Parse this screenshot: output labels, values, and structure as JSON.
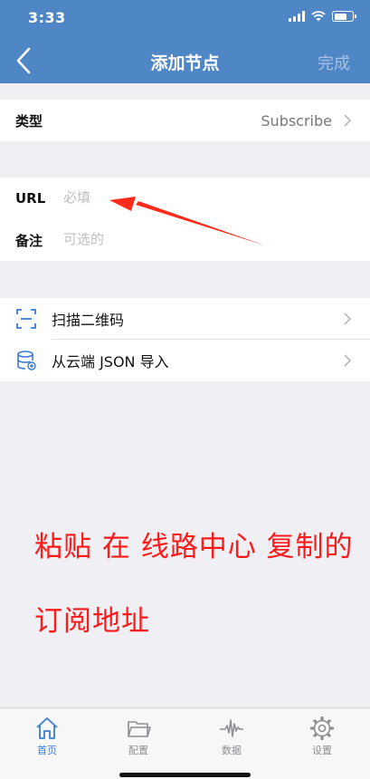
{
  "status_bar": {
    "time": "3:33"
  },
  "nav": {
    "title": "添加节点",
    "done_label": "完成"
  },
  "type_row": {
    "label": "类型",
    "value": "Subscribe"
  },
  "form": {
    "url_label": "URL",
    "url_placeholder": "必填",
    "remark_label": "备注",
    "remark_placeholder": "可选的"
  },
  "menu": {
    "scan_label": "扫描二维码",
    "import_label": "从云端 JSON 导入"
  },
  "annotation": {
    "line1": "粘贴 在 线路中心 复制的",
    "line2": "订阅地址",
    "color": "#ff1a1a"
  },
  "tabbar": {
    "tabs": [
      {
        "label": "首页",
        "icon": "home-icon",
        "active": true
      },
      {
        "label": "配置",
        "icon": "folder-icon",
        "active": false
      },
      {
        "label": "数据",
        "icon": "waveform-icon",
        "active": false
      },
      {
        "label": "设置",
        "icon": "gear-icon",
        "active": false
      }
    ]
  },
  "colors": {
    "nav_bg": "#4f86c6",
    "tab_active": "#3b7bd6",
    "page_bg": "#f0eff4"
  }
}
